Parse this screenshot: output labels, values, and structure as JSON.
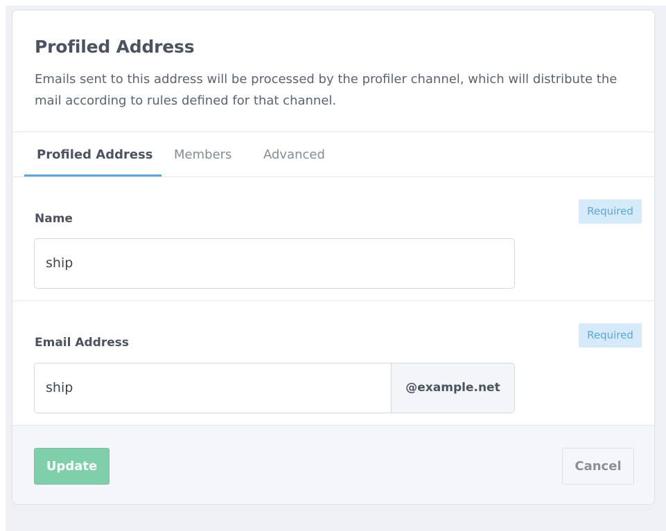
{
  "header": {
    "title": "Profiled Address",
    "description": "Emails sent to this address will be processed by the profiler channel, which will distribute the mail according to rules defined for that channel."
  },
  "tabs": [
    {
      "label": "Profiled Address",
      "active": true
    },
    {
      "label": "Members",
      "active": false
    },
    {
      "label": "Advanced",
      "active": false
    }
  ],
  "fields": {
    "name": {
      "label": "Name",
      "required_label": "Required",
      "value": "ship"
    },
    "email": {
      "label": "Email Address",
      "required_label": "Required",
      "value": "ship",
      "domain_suffix": "@example.net"
    }
  },
  "footer": {
    "update_label": "Update",
    "cancel_label": "Cancel"
  },
  "colors": {
    "accent": "#5aa6e0",
    "update_button": "#7fcfaa",
    "required_badge_bg": "#d6ebfa"
  }
}
